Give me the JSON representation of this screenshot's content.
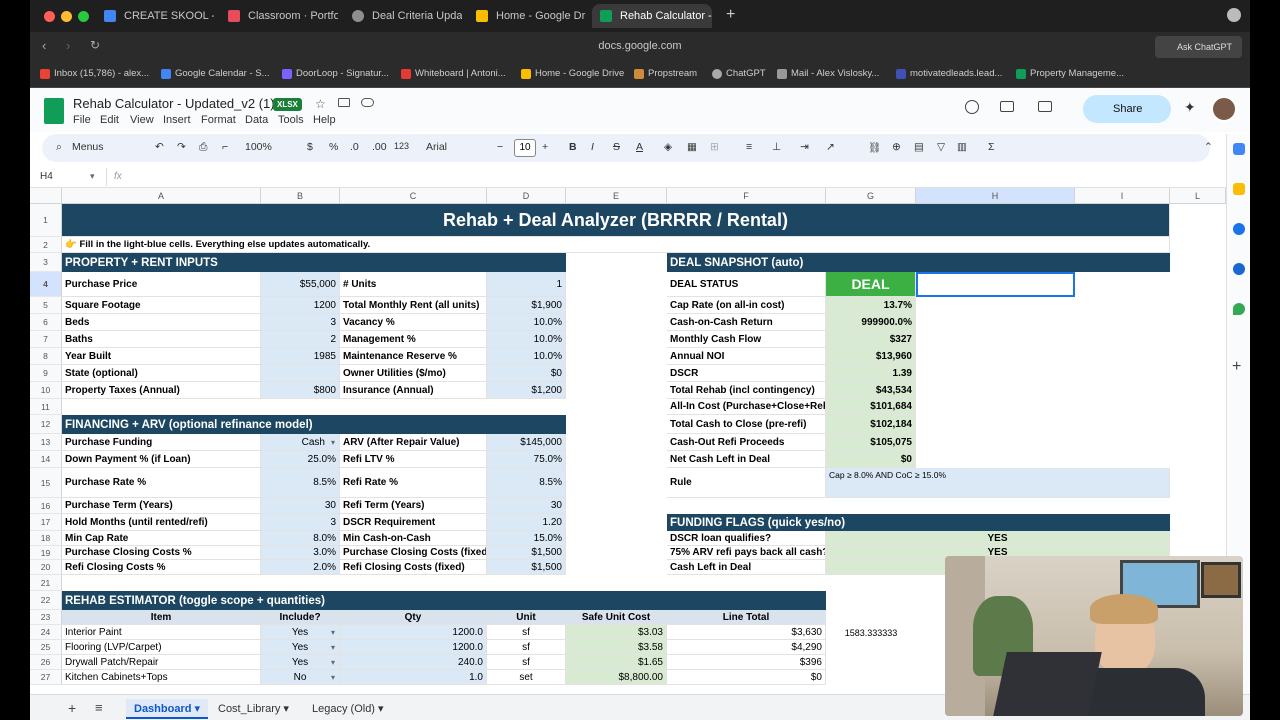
{
  "browser": {
    "tabs": [
      {
        "label": "CREATE SKOOL - Go",
        "color": "#4285f4"
      },
      {
        "label": "Classroom · Portfolio",
        "color": "#e94b5a"
      },
      {
        "label": "Deal Criteria Update",
        "color": "#8e8e8e"
      },
      {
        "label": "Home - Google Drive",
        "color": "#fbbc04"
      },
      {
        "label": "Rehab Calculator - U",
        "color": "#0f9d58"
      }
    ],
    "new_tab": "+",
    "url": "docs.google.com",
    "ask_chatgpt": "Ask ChatGPT",
    "bookmarks": [
      {
        "label": "Inbox (15,786) - alex...",
        "color": "#ea4335"
      },
      {
        "label": "Google Calendar - S...",
        "color": "#4285f4"
      },
      {
        "label": "DoorLoop - Signatur...",
        "color": "#7b61ff"
      },
      {
        "label": "Whiteboard | Antoni...",
        "color": "#e53935"
      },
      {
        "label": "Home - Google Drive",
        "color": "#fbbc04"
      },
      {
        "label": "Propstream",
        "color": "#d08a3c"
      },
      {
        "label": "ChatGPT",
        "color": "#aaaaaa"
      },
      {
        "label": "Mail - Alex Vislosky...",
        "color": "#999999"
      },
      {
        "label": "motivatedleads.lead...",
        "color": "#3f51b5"
      },
      {
        "label": "Property Manageme...",
        "color": "#0f9d58"
      }
    ]
  },
  "doc": {
    "title": "Rehab Calculator - Updated_v2 (1)",
    "badge": "XLSX",
    "menus": [
      "File",
      "Edit",
      "View",
      "Insert",
      "Format",
      "Data",
      "Tools",
      "Help"
    ],
    "share": "Share"
  },
  "toolbar": {
    "menus_search": "Menus",
    "zoom": "100%",
    "currency": "$",
    "percent": "%",
    "dec_less": ".0",
    "dec_more": ".00",
    "num_fmt": "123",
    "font": "Arial",
    "font_size": "10"
  },
  "formula_bar": {
    "cell_ref": "H4",
    "fx": "fx",
    "value": ""
  },
  "columns": [
    "A",
    "B",
    "C",
    "D",
    "E",
    "F",
    "G",
    "H",
    "I",
    "L"
  ],
  "rows": [
    "1",
    "2",
    "3",
    "4",
    "5",
    "6",
    "7",
    "8",
    "9",
    "10",
    "11",
    "12",
    "13",
    "14",
    "15",
    "16",
    "17",
    "18",
    "19",
    "20",
    "21",
    "22",
    "23",
    "24",
    "25",
    "26",
    "27"
  ],
  "sheet": {
    "title": "Rehab + Deal Analyzer (BRRRR / Rental)",
    "hint": "👉 Fill in the light-blue cells. Everything else updates automatically.",
    "property_header": "PROPERTY + RENT INPUTS",
    "property_left": [
      {
        "label": "Purchase Price",
        "value": "$55,000"
      },
      {
        "label": "Square Footage",
        "value": "1200"
      },
      {
        "label": "Beds",
        "value": "3"
      },
      {
        "label": "Baths",
        "value": "2"
      },
      {
        "label": "Year Built",
        "value": "1985"
      },
      {
        "label": "State (optional)",
        "value": ""
      },
      {
        "label": "Property Taxes (Annual)",
        "value": "$800"
      }
    ],
    "property_right": [
      {
        "label": "# Units",
        "value": "1"
      },
      {
        "label": "Total Monthly Rent (all units)",
        "value": "$1,900"
      },
      {
        "label": "Vacancy %",
        "value": "10.0%"
      },
      {
        "label": "Management %",
        "value": "10.0%"
      },
      {
        "label": "Maintenance Reserve %",
        "value": "10.0%"
      },
      {
        "label": "Owner Utilities ($/mo)",
        "value": "$0"
      },
      {
        "label": "Insurance (Annual)",
        "value": "$1,200"
      }
    ],
    "financing_header": "FINANCING + ARV (optional refinance model)",
    "financing_left": [
      {
        "label": "Purchase Funding",
        "value": "Cash"
      },
      {
        "label": "Down Payment % (if Loan)",
        "value": "25.0%"
      },
      {
        "label": "Purchase Rate %",
        "value": "8.5%"
      },
      {
        "label": "Purchase Term (Years)",
        "value": "30"
      },
      {
        "label": "Hold Months (until rented/refi)",
        "value": "3"
      },
      {
        "label": "Min Cap Rate",
        "value": "8.0%"
      },
      {
        "label": "Purchase Closing Costs %",
        "value": "3.0%"
      },
      {
        "label": "Refi Closing Costs %",
        "value": "2.0%"
      }
    ],
    "financing_right": [
      {
        "label": "ARV (After Repair Value)",
        "value": "$145,000"
      },
      {
        "label": "Refi LTV %",
        "value": "75.0%"
      },
      {
        "label": "Refi Rate %",
        "value": "8.5%"
      },
      {
        "label": "Refi Term (Years)",
        "value": "30"
      },
      {
        "label": "DSCR Requirement",
        "value": "1.20"
      },
      {
        "label": "Min Cash-on-Cash",
        "value": "15.0%"
      },
      {
        "label": "Purchase Closing Costs (fixed)",
        "value": "$1,500"
      },
      {
        "label": "Refi Closing Costs (fixed)",
        "value": "$1,500"
      }
    ],
    "snapshot_header": "DEAL SNAPSHOT (auto)",
    "deal_status_label": "DEAL STATUS",
    "deal_status_value": "DEAL",
    "snapshot": [
      {
        "label": "Cap Rate (on all-in cost)",
        "value": "13.7%"
      },
      {
        "label": "Cash-on-Cash Return",
        "value": "999900.0%"
      },
      {
        "label": "Monthly Cash Flow",
        "value": "$327"
      },
      {
        "label": "Annual NOI",
        "value": "$13,960"
      },
      {
        "label": "DSCR",
        "value": "1.39"
      },
      {
        "label": "Total Rehab (incl contingency)",
        "value": "$43,534"
      },
      {
        "label": "All-In Cost (Purchase+Close+Rehab)",
        "value": "$101,684"
      },
      {
        "label": "Total Cash to Close (pre-refi)",
        "value": "$102,184"
      },
      {
        "label": "Cash-Out Refi Proceeds",
        "value": "$105,075"
      },
      {
        "label": "Net Cash Left in Deal",
        "value": "$0"
      }
    ],
    "rule_label": "Rule",
    "rule_value": "Cap ≥ 8.0% AND CoC ≥ 15.0%",
    "flags_header": "FUNDING FLAGS (quick yes/no)",
    "flags": [
      {
        "label": "DSCR loan qualifies?",
        "value": "YES"
      },
      {
        "label": "75% ARV refi pays back all cash?",
        "value": "YES"
      },
      {
        "label": "Cash Left in Deal",
        "value": ""
      }
    ],
    "rehab_header": "REHAB ESTIMATOR (toggle scope + quantities)",
    "rehab_columns": [
      "Item",
      "Include?",
      "Qty",
      "Unit",
      "Safe Unit Cost",
      "Line Total"
    ],
    "rehab_rows": [
      {
        "item": "Interior Paint",
        "include": "Yes",
        "qty": "1200.0",
        "unit": "sf",
        "cost": "$3.03",
        "total": "$3,630"
      },
      {
        "item": "Flooring (LVP/Carpet)",
        "include": "Yes",
        "qty": "1200.0",
        "unit": "sf",
        "cost": "$3.58",
        "total": "$4,290"
      },
      {
        "item": "Drywall Patch/Repair",
        "include": "Yes",
        "qty": "240.0",
        "unit": "sf",
        "cost": "$1.65",
        "total": "$396"
      },
      {
        "item": "Kitchen Cabinets+Tops",
        "include": "No",
        "qty": "1.0",
        "unit": "set",
        "cost": "$8,800.00",
        "total": "$0"
      }
    ],
    "side_value": "1583.333333"
  },
  "sheet_tabs": [
    {
      "label": "Dashboard",
      "active": true
    },
    {
      "label": "Cost_Library",
      "active": false
    },
    {
      "label": "Legacy (Old)",
      "active": false
    }
  ]
}
